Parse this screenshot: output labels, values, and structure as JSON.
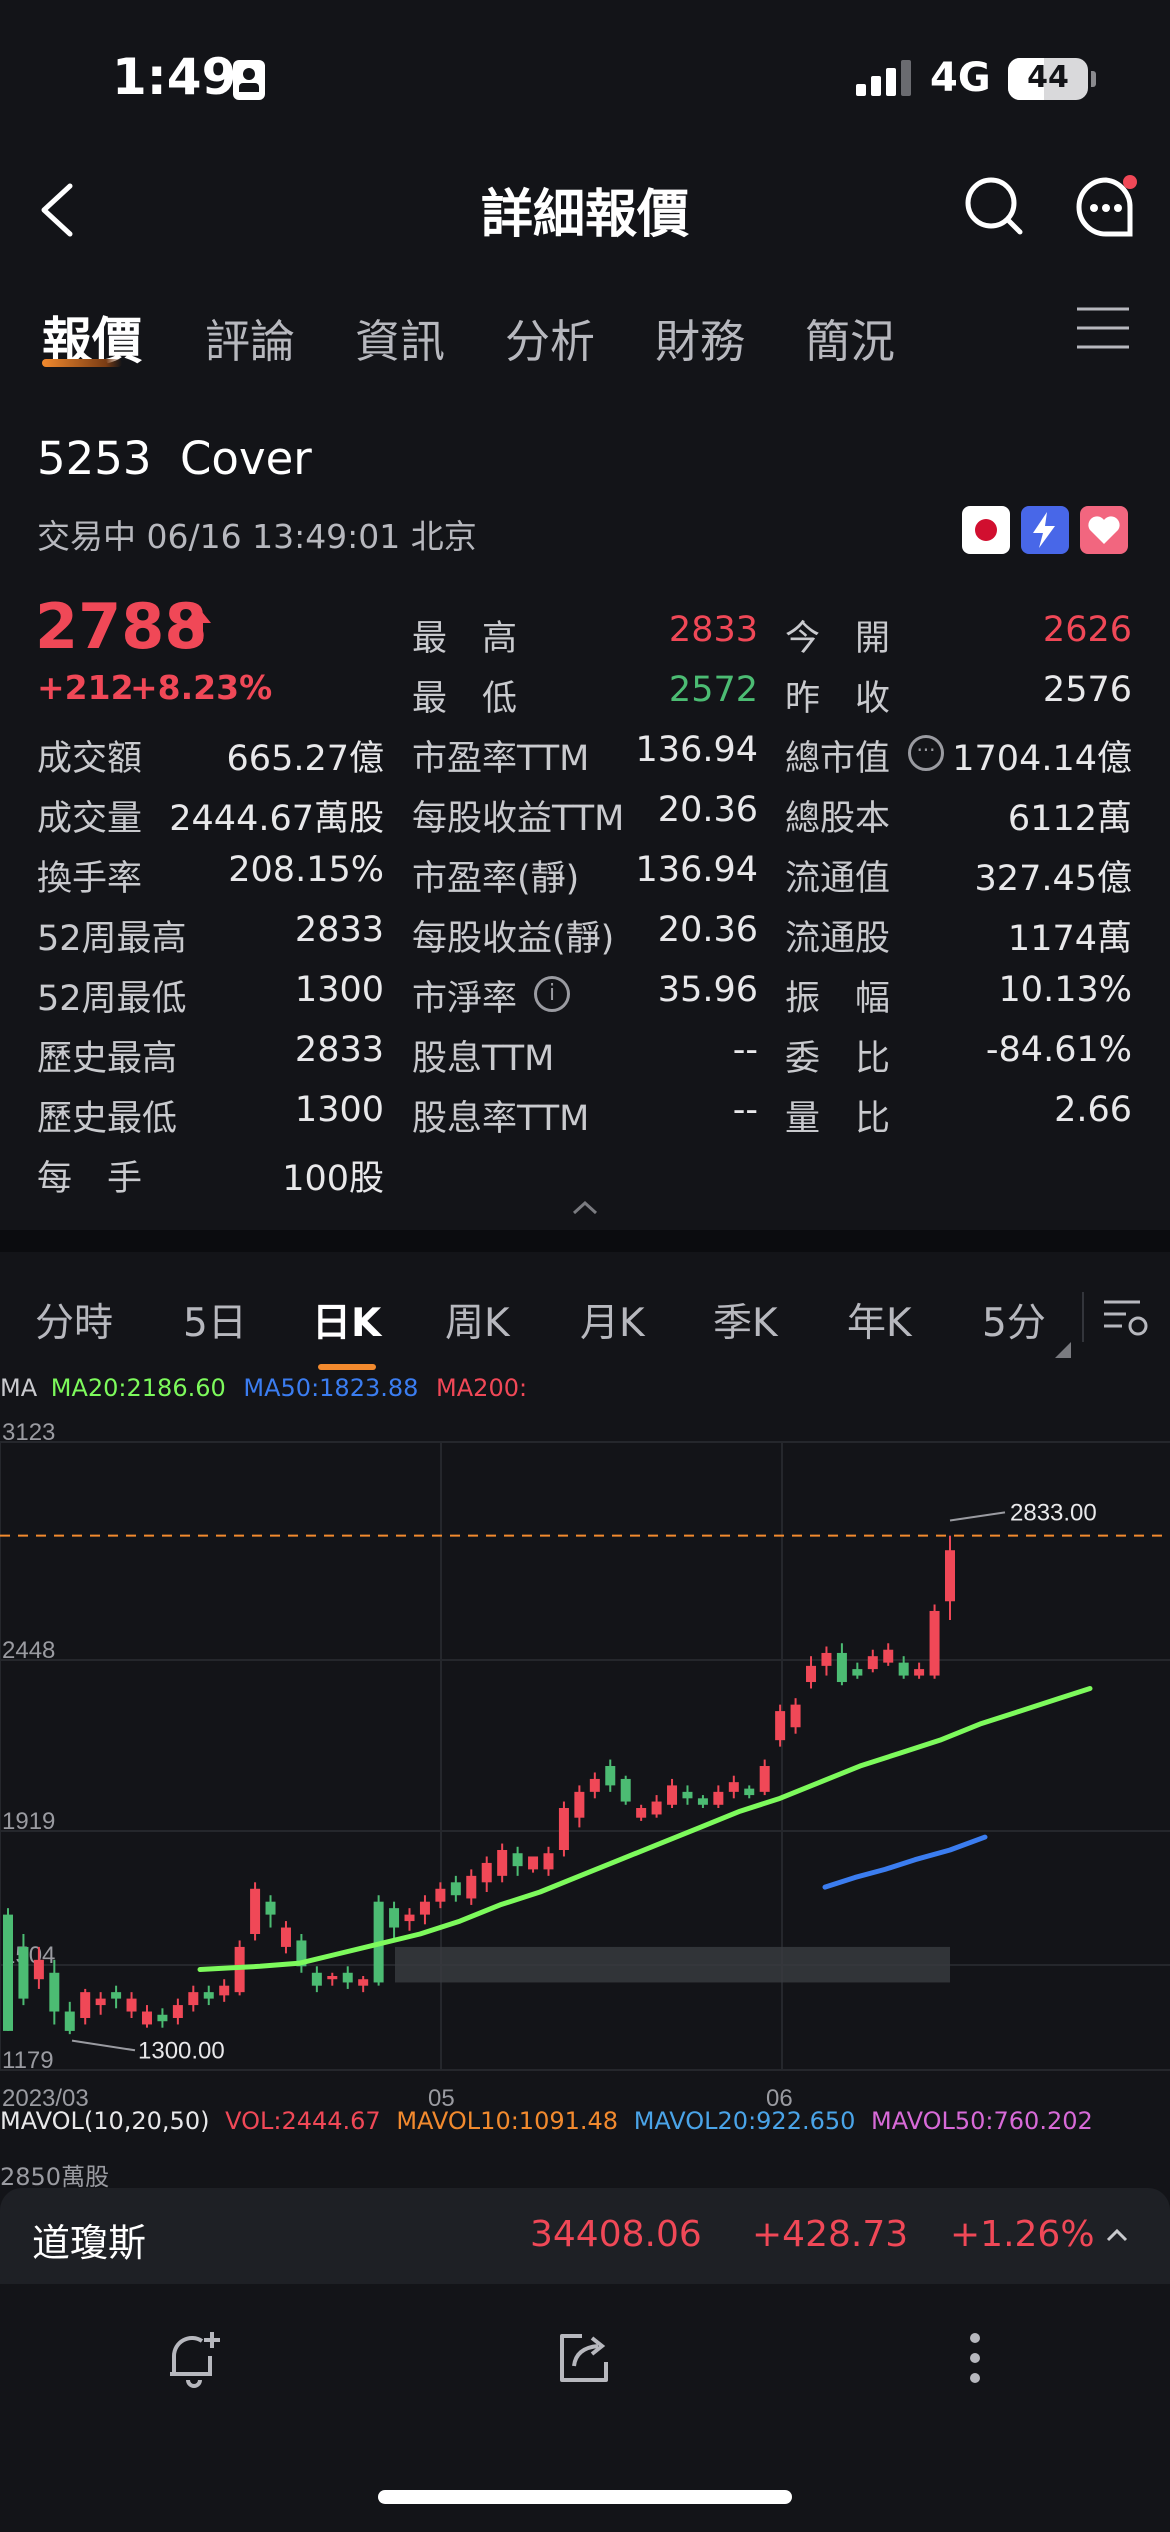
{
  "status_bar": {
    "time": "1:49",
    "network": "4G",
    "battery": "44"
  },
  "nav": {
    "title": "詳細報價"
  },
  "tabs": [
    "報價",
    "評論",
    "資訊",
    "分析",
    "財務",
    "簡況"
  ],
  "stock": {
    "code": "5253",
    "name": "Cover",
    "status": "交易中 06/16 13:49:01 北京",
    "price": "2788",
    "change": "+212",
    "change_pct": "+8.23%",
    "high_label": "最　高",
    "high": "2833",
    "low_label": "最　低",
    "low": "2572",
    "open_label": "今　開",
    "open": "2626",
    "prev_close_label": "昨　收",
    "prev_close": "2576"
  },
  "stats_col1": [
    {
      "label": "成交額",
      "value": "665.27億"
    },
    {
      "label": "成交量",
      "value": "2444.67萬股"
    },
    {
      "label": "換手率",
      "value": "208.15%"
    },
    {
      "label": "52周最高",
      "value": "2833"
    },
    {
      "label": "52周最低",
      "value": "1300"
    },
    {
      "label": "歷史最高",
      "value": "2833"
    },
    {
      "label": "歷史最低",
      "value": "1300"
    },
    {
      "label": "每　手",
      "value": "100股"
    }
  ],
  "stats_col2": [
    {
      "label": "市盈率TTM",
      "value": "136.94"
    },
    {
      "label": "每股收益TTM",
      "value": "20.36"
    },
    {
      "label": "市盈率(靜)",
      "value": "136.94"
    },
    {
      "label": "每股收益(靜)",
      "value": "20.36"
    },
    {
      "label": "市淨率",
      "value": "35.96"
    },
    {
      "label": "股息TTM",
      "value": "--"
    },
    {
      "label": "股息率TTM",
      "value": "--"
    }
  ],
  "stats_col3": [
    {
      "label": "總市值",
      "value": "1704.14億"
    },
    {
      "label": "總股本",
      "value": "6112萬"
    },
    {
      "label": "流通值",
      "value": "327.45億"
    },
    {
      "label": "流通股",
      "value": "1174萬"
    },
    {
      "label": "振　幅",
      "value": "10.13%"
    },
    {
      "label": "委　比",
      "value": "-84.61%"
    },
    {
      "label": "量　比",
      "value": "2.66"
    }
  ],
  "k_tabs": [
    "分時",
    "5日",
    "日K",
    "周K",
    "月K",
    "季K",
    "年K",
    "5分"
  ],
  "ma_legend": {
    "ma": "MA",
    "ma20": "MA20:2186.60",
    "ma50": "MA50:1823.88",
    "ma200": "MA200:"
  },
  "colors": {
    "up": "#f04857",
    "down": "#4cbc73",
    "ma20": "#7dfa5c",
    "ma50": "#3b7df0",
    "ma200": "#f04857",
    "accent": "#f28a2e"
  },
  "chart_data": {
    "type": "candlestick",
    "y_ticks": [
      "3123",
      "2448",
      "1919",
      "1504",
      "1179"
    ],
    "x_ticks": [
      "2023/03",
      "05",
      "06"
    ],
    "high_marker": "2833.00",
    "low_marker": "1300.00",
    "candles": [
      [
        1300,
        1660,
        1300,
        1680,
        "d"
      ],
      [
        1400,
        1560,
        1380,
        1600,
        "d"
      ],
      [
        1460,
        1520,
        1430,
        1560,
        "u"
      ],
      [
        1360,
        1480,
        1320,
        1520,
        "d"
      ],
      [
        1300,
        1360,
        1290,
        1390,
        "d"
      ],
      [
        1340,
        1420,
        1320,
        1430,
        "u"
      ],
      [
        1380,
        1400,
        1350,
        1420,
        "u"
      ],
      [
        1400,
        1420,
        1370,
        1440,
        "d"
      ],
      [
        1360,
        1400,
        1340,
        1420,
        "u"
      ],
      [
        1320,
        1360,
        1310,
        1380,
        "u"
      ],
      [
        1330,
        1350,
        1310,
        1370,
        "d"
      ],
      [
        1340,
        1380,
        1320,
        1400,
        "u"
      ],
      [
        1380,
        1420,
        1360,
        1440,
        "u"
      ],
      [
        1400,
        1420,
        1380,
        1440,
        "d"
      ],
      [
        1410,
        1440,
        1390,
        1460,
        "u"
      ],
      [
        1420,
        1560,
        1410,
        1580,
        "u"
      ],
      [
        1600,
        1740,
        1580,
        1760,
        "u"
      ],
      [
        1660,
        1700,
        1620,
        1720,
        "d"
      ],
      [
        1560,
        1620,
        1540,
        1640,
        "u"
      ],
      [
        1500,
        1580,
        1480,
        1600,
        "d"
      ],
      [
        1440,
        1480,
        1420,
        1500,
        "d"
      ],
      [
        1460,
        1470,
        1440,
        1480,
        "u"
      ],
      [
        1450,
        1480,
        1430,
        1500,
        "d"
      ],
      [
        1440,
        1460,
        1420,
        1470,
        "u"
      ],
      [
        1450,
        1700,
        1440,
        1720,
        "d"
      ],
      [
        1620,
        1680,
        1580,
        1700,
        "d"
      ],
      [
        1640,
        1660,
        1610,
        1680,
        "u"
      ],
      [
        1660,
        1700,
        1630,
        1720,
        "u"
      ],
      [
        1700,
        1740,
        1680,
        1760,
        "u"
      ],
      [
        1720,
        1760,
        1700,
        1780,
        "d"
      ],
      [
        1710,
        1780,
        1690,
        1800,
        "u"
      ],
      [
        1760,
        1820,
        1730,
        1840,
        "u"
      ],
      [
        1780,
        1860,
        1760,
        1880,
        "u"
      ],
      [
        1810,
        1850,
        1780,
        1870,
        "d"
      ],
      [
        1840,
        1800,
        1790,
        1830,
        "u"
      ],
      [
        1800,
        1850,
        1780,
        1870,
        "u"
      ],
      [
        1860,
        1990,
        1840,
        2010,
        "u"
      ],
      [
        1960,
        2040,
        1930,
        2060,
        "u"
      ],
      [
        2040,
        2080,
        2020,
        2100,
        "u"
      ],
      [
        2060,
        2120,
        2040,
        2140,
        "d"
      ],
      [
        2080,
        2010,
        2000,
        2090,
        "d"
      ],
      [
        1990,
        1960,
        1950,
        2000,
        "u"
      ],
      [
        1970,
        2010,
        1960,
        2030,
        "u"
      ],
      [
        2000,
        2060,
        1990,
        2080,
        "u"
      ],
      [
        2020,
        2040,
        2000,
        2060,
        "d"
      ],
      [
        2020,
        2000,
        1990,
        2030,
        "d"
      ],
      [
        2000,
        2040,
        1990,
        2060,
        "u"
      ],
      [
        2040,
        2070,
        2020,
        2090,
        "u"
      ],
      [
        2050,
        2030,
        2020,
        2060,
        "d"
      ],
      [
        2040,
        2120,
        2030,
        2140,
        "u"
      ],
      [
        2200,
        2290,
        2180,
        2310,
        "u"
      ],
      [
        2240,
        2310,
        2220,
        2330,
        "u"
      ],
      [
        2380,
        2430,
        2360,
        2460,
        "u"
      ],
      [
        2430,
        2470,
        2400,
        2490,
        "u"
      ],
      [
        2470,
        2380,
        2370,
        2500,
        "d"
      ],
      [
        2400,
        2420,
        2390,
        2440,
        "d"
      ],
      [
        2420,
        2460,
        2410,
        2480,
        "u"
      ],
      [
        2440,
        2480,
        2430,
        2500,
        "u"
      ],
      [
        2440,
        2400,
        2390,
        2460,
        "d"
      ],
      [
        2420,
        2400,
        2390,
        2440,
        "u"
      ],
      [
        2400,
        2600,
        2390,
        2620,
        "u"
      ],
      [
        2630,
        2788,
        2572,
        2833,
        "u"
      ]
    ],
    "ma20": [
      [
        200,
        1490
      ],
      [
        230,
        1495
      ],
      [
        260,
        1500
      ],
      [
        300,
        1510
      ],
      [
        340,
        1540
      ],
      [
        380,
        1570
      ],
      [
        420,
        1600
      ],
      [
        460,
        1640
      ],
      [
        500,
        1690
      ],
      [
        540,
        1730
      ],
      [
        580,
        1780
      ],
      [
        620,
        1830
      ],
      [
        660,
        1880
      ],
      [
        700,
        1930
      ],
      [
        740,
        1980
      ],
      [
        780,
        2020
      ],
      [
        820,
        2070
      ],
      [
        860,
        2120
      ],
      [
        900,
        2160
      ],
      [
        940,
        2200
      ],
      [
        980,
        2250
      ],
      [
        1020,
        2290
      ],
      [
        1060,
        2330
      ],
      [
        1090,
        2360
      ]
    ],
    "ma50": [
      [
        825,
        1745
      ],
      [
        855,
        1775
      ],
      [
        885,
        1800
      ],
      [
        915,
        1830
      ],
      [
        950,
        1860
      ],
      [
        985,
        1900
      ]
    ]
  },
  "mavol_legend": {
    "label": "MAVOL(10,20,50)",
    "vol": "VOL:2444.67",
    "m10": "MAVOL10:1091.48",
    "m20": "MAVOL20:922.650",
    "m50": "MAVOL50:760.202",
    "axis": "2850萬股"
  },
  "ticker": {
    "name": "道瓊斯",
    "price": "34408.06",
    "change": "+428.73",
    "pct": "+1.26%"
  }
}
